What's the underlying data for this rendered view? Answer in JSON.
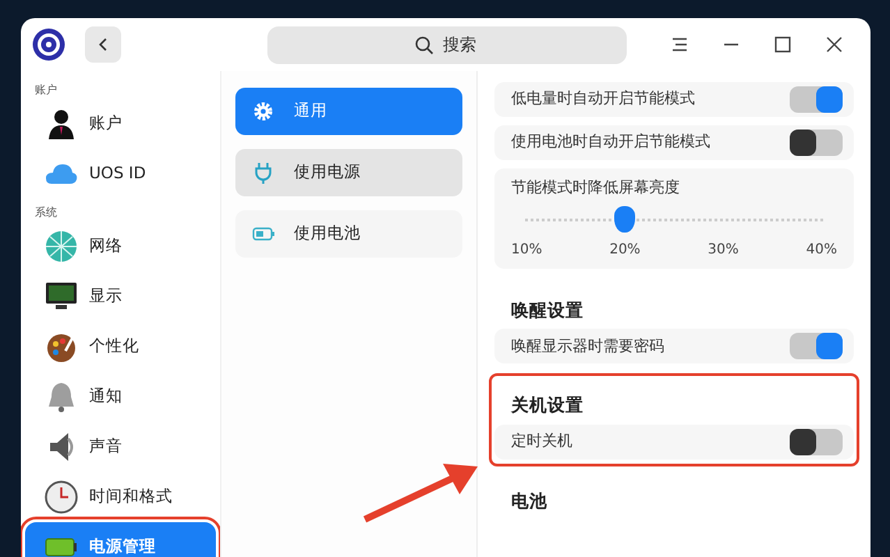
{
  "window": {
    "search_placeholder": "搜索"
  },
  "sidebar": {
    "sections": [
      {
        "title": "账户",
        "items": [
          {
            "label": "账户",
            "selected": false,
            "highlighted": false
          },
          {
            "label": "UOS ID",
            "selected": false,
            "highlighted": false
          }
        ]
      },
      {
        "title": "系统",
        "items": [
          {
            "label": "网络",
            "selected": false,
            "highlighted": false
          },
          {
            "label": "显示",
            "selected": false,
            "highlighted": false
          },
          {
            "label": "个性化",
            "selected": false,
            "highlighted": false
          },
          {
            "label": "通知",
            "selected": false,
            "highlighted": false
          },
          {
            "label": "声音",
            "selected": false,
            "highlighted": false
          },
          {
            "label": "时间和格式",
            "selected": false,
            "highlighted": false
          },
          {
            "label": "电源管理",
            "selected": true,
            "highlighted": true
          }
        ]
      }
    ]
  },
  "submenu": {
    "items": [
      {
        "label": "通用",
        "selected": true,
        "hovered": false
      },
      {
        "label": "使用电源",
        "selected": false,
        "hovered": true
      },
      {
        "label": "使用电池",
        "selected": false,
        "hovered": false
      }
    ]
  },
  "settings": {
    "sections": [
      {
        "highlighted": false,
        "rows": [
          {
            "kind": "toggle",
            "label": "低电量时自动开启节能模式",
            "on": true
          },
          {
            "kind": "toggle",
            "label": "使用电池时自动开启节能模式",
            "on": false
          },
          {
            "kind": "slider",
            "label": "节能模式时降低屏幕亮度",
            "level": 0.333,
            "ticks": [
              "10%",
              "20%",
              "30%",
              "40%"
            ]
          }
        ]
      },
      {
        "title": "唤醒设置",
        "highlighted": false,
        "rows": [
          {
            "kind": "toggle",
            "label": "唤醒显示器时需要密码",
            "on": true
          }
        ]
      },
      {
        "title": "关机设置",
        "highlighted": true,
        "rows": [
          {
            "kind": "toggle",
            "label": "定时关机",
            "on": false
          }
        ]
      },
      {
        "title": "电池",
        "highlighted": false
      }
    ]
  }
}
